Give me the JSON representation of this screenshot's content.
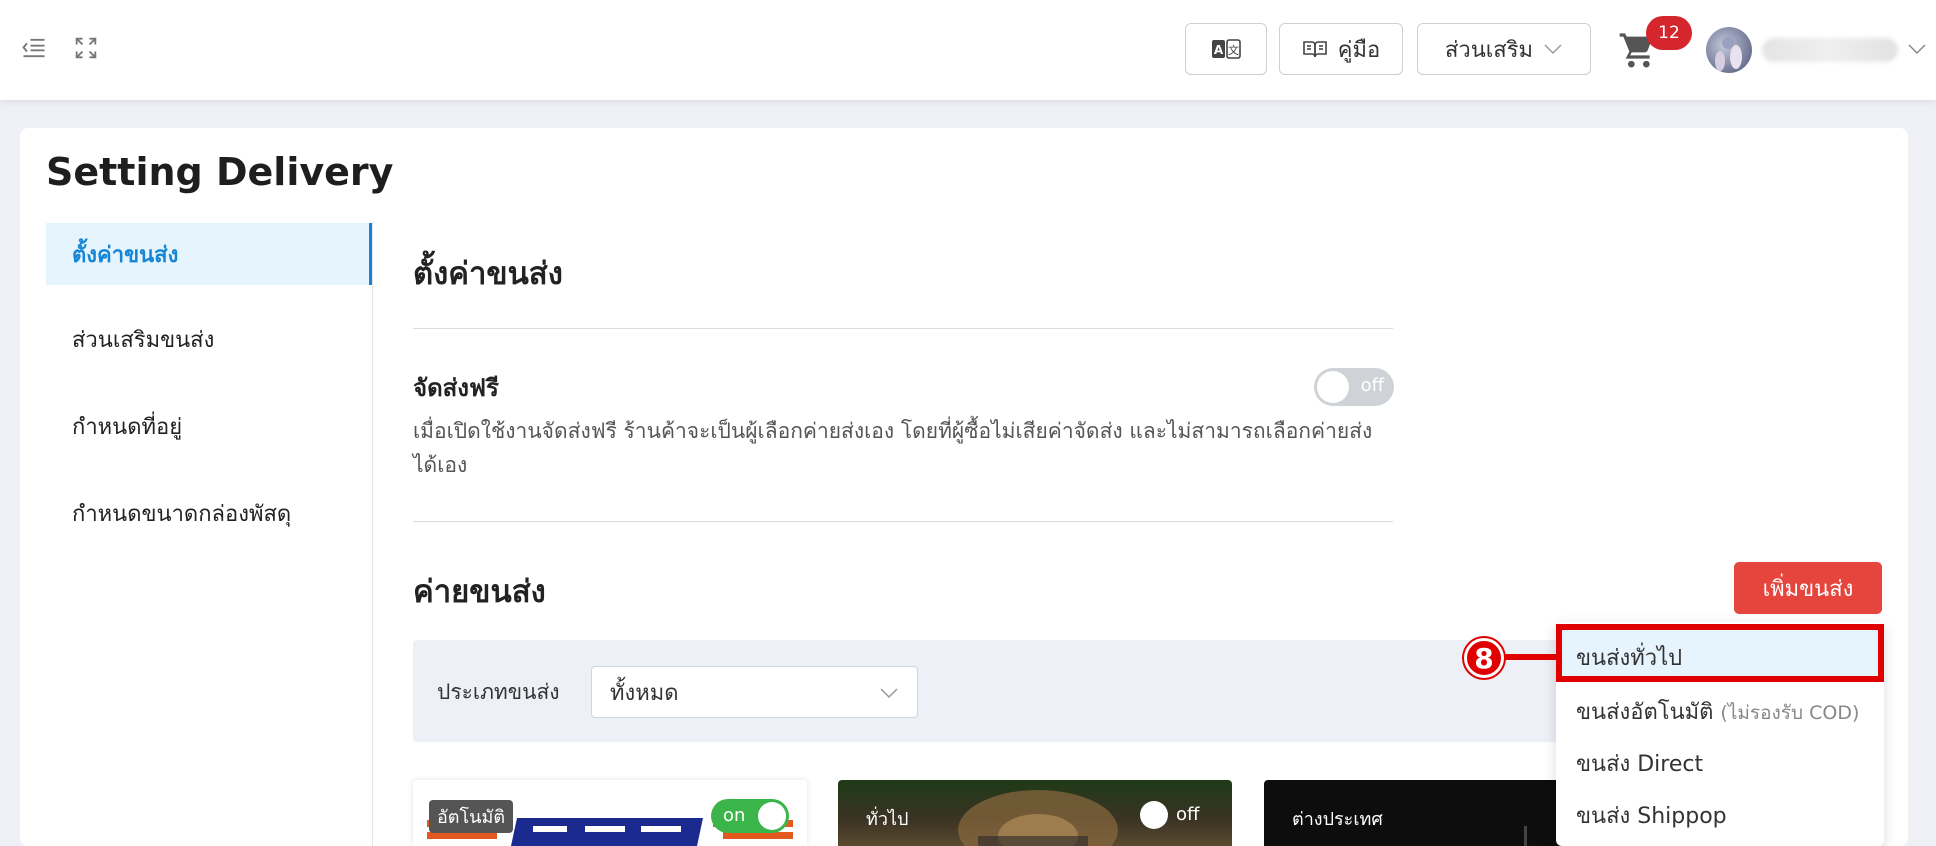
{
  "topbar": {
    "translate_icon": "translate-icon",
    "manual_label": "คู่มือ",
    "addons_label": "ส่วนเสริม",
    "cart_count": "12"
  },
  "page": {
    "title": "Setting Delivery"
  },
  "sidebar": {
    "items": [
      {
        "label": "ตั้งค่าขนส่ง",
        "active": true
      },
      {
        "label": "ส่วนเสริมขนส่ง",
        "active": false
      },
      {
        "label": "กำหนดที่อยู่",
        "active": false
      },
      {
        "label": "กำหนดขนาดกล่องพัสดุ",
        "active": false
      }
    ]
  },
  "main": {
    "heading": "ตั้งค่าขนส่ง",
    "free_shipping": {
      "title": "จัดส่งฟรี",
      "toggle_label": "off",
      "description": "เมื่อเปิดใช้งานจัดส่งฟรี ร้านค้าจะเป็นผู้เลือกค่ายส่งเอง โดยที่ผู้ซื้อไม่เสียค่าจัดส่ง และไม่สามารถเลือกค่ายส่งได้เอง"
    },
    "carriers": {
      "heading": "ค่ายขนส่ง",
      "add_button": "เพิ่มขนส่ง",
      "filter_label": "ประเภทขนส่ง",
      "filter_value": "ทั้งหมด",
      "cards": [
        {
          "tag": "อัตโนมัติ",
          "toggle": "on"
        },
        {
          "tag": "ทั่วไป",
          "toggle": "off"
        },
        {
          "tag": "ต่างประเทศ",
          "toggle": ""
        }
      ]
    },
    "add_dropdown": {
      "items": [
        {
          "label": "ขนส่งทั่วไป",
          "sub": ""
        },
        {
          "label": "ขนส่งอัตโนมัติ",
          "sub": "(ไม่รองรับ COD)"
        },
        {
          "label": "ขนส่ง Direct",
          "sub": ""
        },
        {
          "label": "ขนส่ง Shippop",
          "sub": ""
        }
      ]
    }
  },
  "annotation": {
    "step": "8"
  },
  "colors": {
    "accent": "#1586d6",
    "danger": "#e5453c",
    "callout": "#e00000",
    "on": "#3bb54a"
  }
}
